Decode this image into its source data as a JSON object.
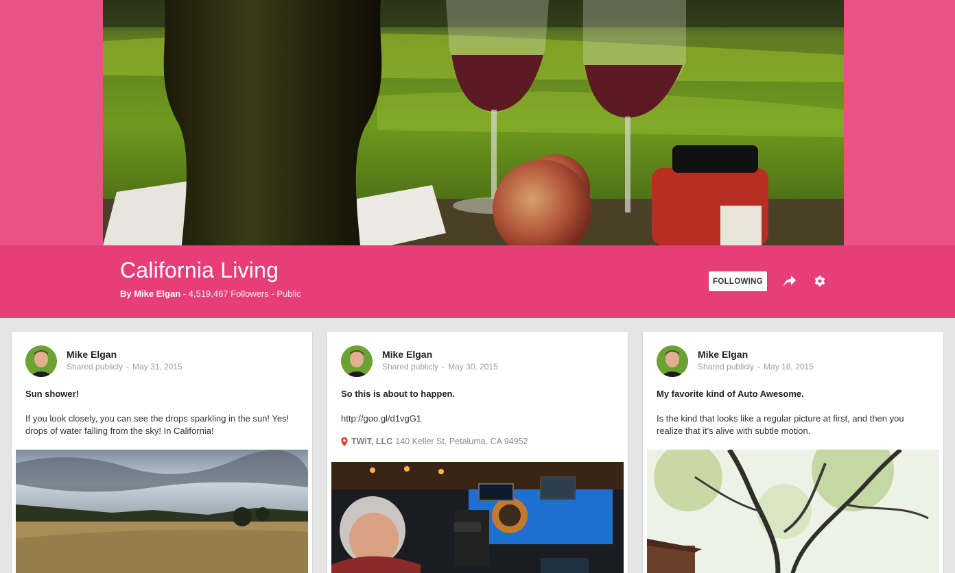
{
  "collection": {
    "title": "California Living",
    "owner": "By Mike Elgan",
    "meta": " - 4,519,467 Followers - Public",
    "follow_label": "FOLLOWING",
    "theme_color": "#e83e78",
    "band_color": "#e95284"
  },
  "icons": {
    "share": "share-arrow-icon",
    "settings": "gear-icon",
    "location": "map-pin-icon"
  },
  "posts": [
    {
      "author": "Mike Elgan",
      "visibility": "Shared publicly",
      "separator": "-",
      "date": "May 31, 2015",
      "headline": "Sun shower!",
      "body": "If you look closely, you can see the drops sparkling in the sun! Yes! drops of water falling from the sky! In California!"
    },
    {
      "author": "Mike Elgan",
      "visibility": "Shared publicly",
      "separator": "-",
      "date": "May 30, 2015",
      "headline": "So this is about to happen.",
      "body": "http://goo.gl/d1vgG1",
      "location_name": "TWiT, LLC",
      "location_address": "140 Keller St, Petaluma, CA 94952"
    },
    {
      "author": "Mike Elgan",
      "visibility": "Shared publicly",
      "separator": "-",
      "date": "May 18, 2015",
      "headline": "My favorite kind of Auto Awesome.",
      "body": "Is the kind that looks like a regular picture at first, and then you realize that it's alive with subtle motion."
    }
  ]
}
